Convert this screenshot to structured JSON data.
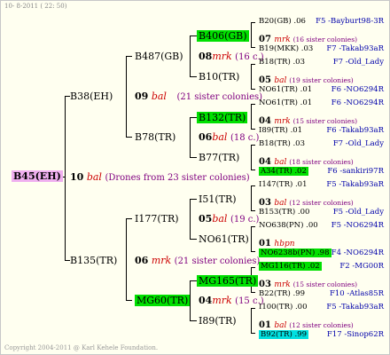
{
  "header": {
    "date": "10-  8-2011 ( 22: 50)"
  },
  "footer": {
    "copyright": "Copyright 2004-2011 @ Karl Kehele Foundation."
  },
  "root": {
    "id": "B45(EH)",
    "num": "10",
    "breed": "bal",
    "note": "(Drones from 23 sister colonies)"
  },
  "gen1": {
    "b38": {
      "id": "B38(EH)",
      "num": "09",
      "breed": "bal",
      "note": "(21 sister colonies)"
    },
    "b135": {
      "id": "B135(TR)",
      "num": "06",
      "breed": "mrk",
      "note": "(21 sister colonies)"
    }
  },
  "gen2": {
    "b487": {
      "id": "B487(GB)",
      "num": "08",
      "breed": "mrk",
      "note": "(16 c.)"
    },
    "b78": {
      "id": "B78(TR)",
      "num": "06",
      "breed": "bal",
      "note": "(18 c.)"
    },
    "i177": {
      "id": "I177(TR)",
      "num": "05",
      "breed": "bal",
      "note": "(19 c.)"
    },
    "mg60": {
      "id": "MG60(TR)",
      "num": "04",
      "breed": "mrk",
      "note": "(15 c.)"
    }
  },
  "gen3": {
    "b406": "B406(GB)",
    "b10": "B10(TR)",
    "b132": "B132(TR)",
    "b77": "B77(TR)",
    "i51": "I51(TR)",
    "no61": "NO61(TR)",
    "mg165": "MG165(TR)",
    "i89": "I89(TR)"
  },
  "gen4": [
    {
      "id": "B20(GB)",
      "y": ".06",
      "c": "F5 -Bayburt98-3R"
    },
    {
      "num": "07",
      "breed": "mrk",
      "note": "(16 sister colonies)"
    },
    {
      "id": "B19(MKK)",
      "y": ".03",
      "c": "F7 -Takab93aR"
    },
    {
      "id": "B18(TR)",
      "y": ".03",
      "c": "F7 -Old_Lady"
    },
    {
      "num": "05",
      "breed": "bal",
      "note": "(19 sister colonies)"
    },
    {
      "id": "NO61(TR)",
      "y": ".01",
      "c": "F6 -NO6294R"
    },
    {
      "id": "NO61(TR)",
      "y": ".01",
      "c": "F6 -NO6294R"
    },
    {
      "num": "04",
      "breed": "mrk",
      "note": "(15 sister colonies)"
    },
    {
      "id": "I89(TR)",
      "y": ".01",
      "c": "F6 -Takab93aR"
    },
    {
      "id": "B18(TR)",
      "y": ".03",
      "c": "F7 -Old_Lady"
    },
    {
      "num": "04",
      "breed": "bal",
      "note": "(18 sister colonies)"
    },
    {
      "id": "A34(TR)",
      "y": ".02",
      "c": "F6 -sankiri97R"
    },
    {
      "id": "I147(TR)",
      "y": ".01",
      "c": "F5 -Takab93aR"
    },
    {
      "num": "03",
      "breed": "bal",
      "note": "(12 sister colonies)"
    },
    {
      "id": "B153(TR)",
      "y": ".00",
      "c": "F5 -Old_Lady"
    },
    {
      "id": "NO638(PN)",
      "y": ".00",
      "c": "F5 -NO6294R"
    },
    {
      "num": "01",
      "breed": "hbpn",
      "note": ""
    },
    {
      "id": "NO6238b(PN)",
      "y": ".98",
      "c": "F4 -NO6294R"
    },
    {
      "id": "MG116(TR)",
      "y": ".02",
      "c": "F2 -MG00R"
    },
    {
      "num": "03",
      "breed": "mrk",
      "note": "(15 sister colonies)"
    },
    {
      "id": "B22(TR)",
      "y": ".99",
      "c": "F10 -Atlas85R"
    },
    {
      "id": "I100(TR)",
      "y": ".00",
      "c": "F5 -Takab93aR"
    },
    {
      "num": "01",
      "breed": "bal",
      "note": "(12 sister colonies)"
    },
    {
      "id": "B92(TR)",
      "y": ".99",
      "c": "F17 -Sinop62R"
    }
  ],
  "colors": {
    "highlight": "#00e000",
    "highlight_cyan": "#00e0e0",
    "root_highlight": "#f0b0f0",
    "breed": "#cc0000",
    "note": "#800080",
    "colony": "#0000aa"
  }
}
